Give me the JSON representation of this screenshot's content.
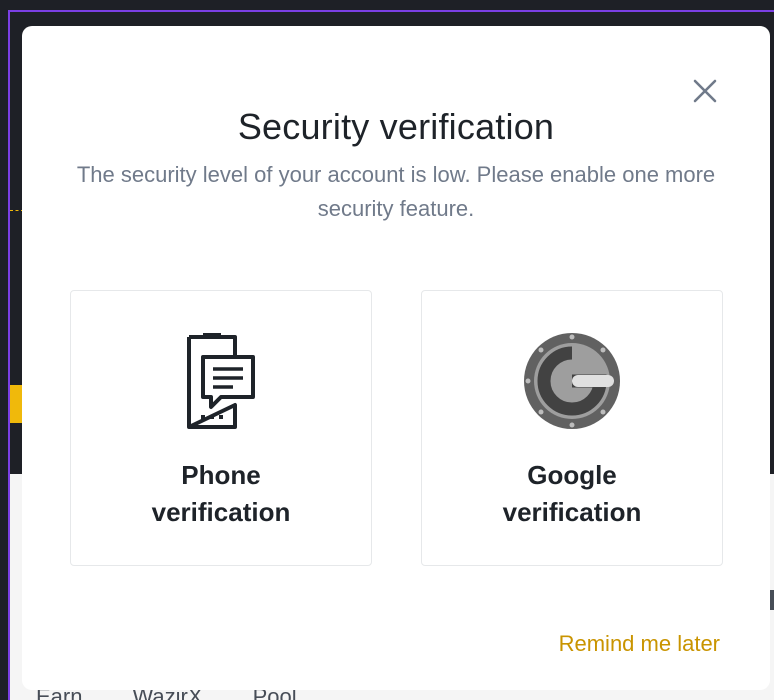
{
  "modal": {
    "title": "Security verification",
    "description": "The security level of your account is low. Please enable one more security feature.",
    "options": [
      {
        "label": "Phone\nverification",
        "icon": "phone-message-icon"
      },
      {
        "label": "Google\nverification",
        "icon": "google-authenticator-icon"
      }
    ],
    "remind_later": "Remind me later",
    "close_icon": "close-icon"
  },
  "background": {
    "tabs": [
      "Earn",
      "WazirX",
      "Pool"
    ]
  },
  "colors": {
    "accent": "#c99400",
    "title": "#1e2329",
    "muted": "#707a8a",
    "frame": "#7b3fe4"
  }
}
